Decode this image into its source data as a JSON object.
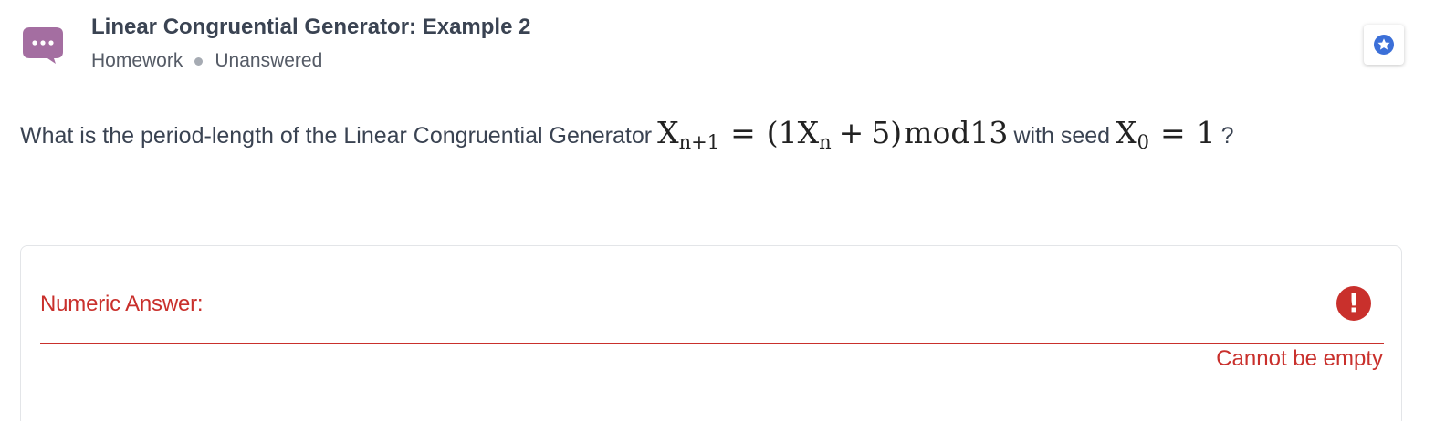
{
  "header": {
    "title": "Linear Congruential Generator: Example 2",
    "category": "Homework",
    "status": "Unanswered",
    "chat_icon": "speech-bubble-ellipsis-icon",
    "favorite_icon": "star-badge-icon"
  },
  "question": {
    "prefix": "What is the period-length of the Linear Congruential Generator",
    "formula": {
      "lhs_var": "X",
      "lhs_sub": "n+1",
      "equals": "=",
      "paren_open": "(1X",
      "mid_sub": "n",
      "plus": "+",
      "tail": "5)",
      "mod": "mod13"
    },
    "middle": "with seed",
    "seed": {
      "var": "X",
      "sub": "0",
      "equals": "=",
      "value": "1"
    },
    "suffix": "?"
  },
  "answer": {
    "label": "Numeric Answer:",
    "value": "",
    "error_symbol": "!",
    "error_message": "Cannot be empty"
  },
  "colors": {
    "accent_purple": "#a46ea1",
    "error_red": "#c9302c",
    "favorite_blue": "#3b6fd8",
    "title_text": "#3a4352"
  }
}
